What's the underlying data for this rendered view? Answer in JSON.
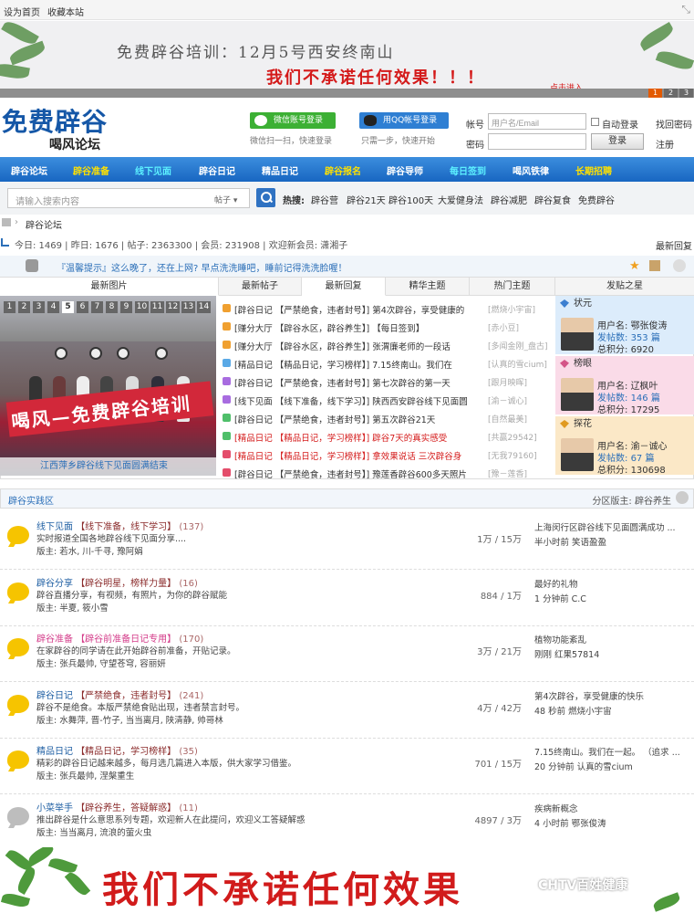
{
  "topbar": {
    "set_home": "设为首页",
    "bookmark": "收藏本站"
  },
  "banner": {
    "line1": "免费辟谷培训：12月5号西安终南山",
    "line2": "我们不承诺任何效果！！！",
    "cta": "点击进入",
    "pages": [
      "1",
      "2",
      "3"
    ]
  },
  "logo": {
    "main": "免费辟谷",
    "sub": "喝风论坛"
  },
  "login": {
    "wechat_btn": "微信账号登录",
    "wechat_sub": "微信扫一扫，快速登录",
    "qq_btn": "用QQ帐号登录",
    "qq_sub": "只需一步，快速开始",
    "account_label": "帐号",
    "account_placeholder": "用户名/Email",
    "auto_login": "自动登录",
    "forgot": "找回密码",
    "password_label": "密码",
    "login_btn": "登录",
    "register": "注册"
  },
  "nav": [
    "辟谷论坛",
    "辟谷准备",
    "线下见面",
    "辟谷日记",
    "精品日记",
    "辟谷报名",
    "辟谷导师",
    "每日签到",
    "喝风铁律",
    "长期招聘"
  ],
  "search": {
    "placeholder": "请输入搜索内容",
    "scope": "帖子 ▾",
    "hot_label": "热搜:",
    "hot": [
      "辟谷营",
      "辟谷21天",
      "辟谷100天",
      "大爱健身法",
      "辟谷减肥",
      "辟谷复食",
      "免费辟谷"
    ]
  },
  "breadcrumb": "辟谷论坛",
  "stats": {
    "text": "今日: 1469 | 昨日: 1676 | 帖子: 2363300 | 会员: 231908 | 欢迎新会员: 潇湘子",
    "recent": "最新回复"
  },
  "tip": "『温馨提示』这么晚了，还在上网? 早点洗洗睡吧，睡前记得洗洗脸喔！",
  "tabs": [
    "最新图片",
    "最新帖子",
    "最新回复",
    "精华主题",
    "热门主题",
    "发贴之星"
  ],
  "photo": {
    "numbers": [
      "1",
      "2",
      "3",
      "4",
      "5",
      "6",
      "7",
      "8",
      "9",
      "10",
      "11",
      "12",
      "13",
      "14"
    ],
    "banner_text": "喝风—免费辟谷培训",
    "caption": "江西萍乡辟谷线下见面圆满结束"
  },
  "threads": [
    {
      "text": "[辟谷日记 【严禁绝食，违者封号】] 第4次辟谷，享受健康的",
      "author": "[燃烧小宇宙]",
      "color": "#f0a030",
      "red": false
    },
    {
      "text": "[赚分大厅 【辟谷水区，辟谷养生】] 【每日签到】",
      "author": "[赤小豆]",
      "color": "#f0a030",
      "red": false
    },
    {
      "text": "[赚分大厅 【辟谷水区，辟谷养生】] 张渭廉老师的一段话",
      "author": "[多闻金刚_盘古]",
      "color": "#f0a030",
      "red": false
    },
    {
      "text": "[精品日记 【精品日记，学习榜样】] 7.15终南山。我们在",
      "author": "[认真的雪cium]",
      "color": "#5aa9e6",
      "red": false
    },
    {
      "text": "[辟谷日记 【严禁绝食，违者封号】] 第七次辟谷的第一天",
      "author": "[跟月映晖]",
      "color": "#a86ce0",
      "red": false
    },
    {
      "text": "[线下见面 【线下准备，线下学习】] 陕西西安辟谷线下见面圆",
      "author": "[渝－诚心]",
      "color": "#a86ce0",
      "red": false
    },
    {
      "text": "[辟谷日记 【严禁绝食，违者封号】] 第五次辟谷21天",
      "author": "[自然最美]",
      "color": "#4fbf6a",
      "red": false
    },
    {
      "text": "[精品日记 【精品日记，学习榜样】] 辟谷7天的真实感受",
      "author": "[共赢29542]",
      "color": "#4fbf6a",
      "red": true
    },
    {
      "text": "[精品日记 【精品日记，学习榜样】] 拿效果说话 三次辟谷身",
      "author": "[无我79160]",
      "color": "#e44d6b",
      "red": true
    },
    {
      "text": "[辟谷日记 【严禁绝食，违者封号】] 豫莲香辟谷600多天照片",
      "author": "[豫－莲香]",
      "color": "#e44d6b",
      "red": false
    }
  ],
  "stars": [
    {
      "rank": "状元",
      "user": "鄂张俊涛",
      "posts": "353",
      "score": "6920",
      "bg": "#dcecfb",
      "icon": "#3c7fd0"
    },
    {
      "rank": "榜眼",
      "user": "辽枫叶",
      "posts": "146",
      "score": "17295",
      "bg": "#fadbe8",
      "icon": "#d45588"
    },
    {
      "rank": "探花",
      "user": "渝－诚心",
      "posts": "67",
      "score": "130698",
      "bg": "#fbe8c7",
      "icon": "#e09a20"
    }
  ],
  "star_labels": {
    "user": "用户名: ",
    "posts": "发帖数: ",
    "posts_unit": " 篇",
    "score": "总积分: "
  },
  "section": {
    "title": "辟谷实践区",
    "moderator": "分区版主: 辟谷养生"
  },
  "forums": [
    {
      "name": "线下见面",
      "tag": "【线下准备，线下学习】",
      "count": "(137)",
      "desc": "实时报道全国各地辟谷线下见面分享....",
      "mods": "版主: 若水, 川-千寻, 豫阿娟",
      "nums": "1万 / 15万",
      "last": "上海闵行区辟谷线下见面圆满成功 ...",
      "time": "半小时前 笑语盈盈",
      "gray": false,
      "pink": false
    },
    {
      "name": "辟谷分享",
      "tag": "【辟谷明星，榜样力量】",
      "count": "(16)",
      "desc": "辟谷直播分享，有视频，有照片，为你的辟谷赋能",
      "mods": "版主: 半夏, 筱小雪",
      "nums": "884 / 1万",
      "last": "最好的礼物",
      "time": "1 分钟前 C.C",
      "gray": false,
      "pink": false
    },
    {
      "name": "辟谷准备",
      "tag": "【辟谷前准备日记专用】",
      "count": "(170)",
      "desc": "在家辟谷的同学请在此开始辟谷前准备，开贴记录。",
      "mods": "版主: 张兵最帅, 守望苍穹, 容丽妍",
      "nums": "3万 / 21万",
      "last": "植物功能紊乱",
      "time": "刚刚 红果57814",
      "gray": false,
      "pink": true
    },
    {
      "name": "辟谷日记",
      "tag": "【严禁绝食，违者封号】",
      "count": "(241)",
      "desc": "辟谷不是绝食。本版严禁绝食贴出现，违者禁言封号。",
      "mods": "版主: 水舞萍, 晋-竹子, 当当离月, 陕清静, 帅哥林",
      "nums": "4万 / 42万",
      "last": "第4次辟谷，享受健康的快乐",
      "time": "48 秒前 燃烧小宇宙",
      "gray": false,
      "pink": false
    },
    {
      "name": "精品日记",
      "tag": "【精品日记，学习榜样】",
      "count": "(35)",
      "desc": "精彩的辟谷日记越来越多，每月选几篇进入本版，供大家学习借鉴。",
      "mods": "版主: 张兵最帅, 涅槃重生",
      "nums": "701 / 15万",
      "last": "7.15终南山。我们在一起。 （追求 ...",
      "time": "20 分钟前 认真的雪cium",
      "gray": false,
      "pink": false
    },
    {
      "name": "小菜举手",
      "tag": "【辟谷养生，答疑解惑】",
      "count": "(11)",
      "desc": "推出辟谷是什么意思系列专题，欢迎新人在此提问，欢迎义工答疑解惑",
      "mods": "版主: 当当离月, 流浪的萤火虫",
      "nums": "4897 / 3万",
      "last": "疾病新概念",
      "time": "4 小时前 鄂张俊涛",
      "gray": true,
      "pink": false
    }
  ],
  "bottom": {
    "big": "我们不承诺任何效果",
    "watermark": "CHTV百姓健康"
  }
}
